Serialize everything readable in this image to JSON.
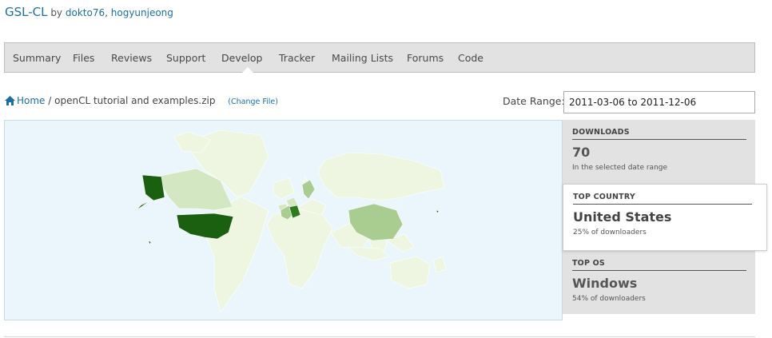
{
  "header": {
    "project_title": "GSL-CL",
    "by_text": "by",
    "authors": [
      "dokto76",
      "hogyunjeong"
    ],
    "separator": ","
  },
  "nav": {
    "tabs": [
      {
        "label": "Summary"
      },
      {
        "label": "Files"
      },
      {
        "label": "Reviews"
      },
      {
        "label": "Support"
      },
      {
        "label": "Develop",
        "active": true
      },
      {
        "label": "Tracker"
      },
      {
        "label": "Mailing Lists"
      },
      {
        "label": "Forums"
      },
      {
        "label": "Code"
      }
    ]
  },
  "breadcrumb": {
    "home_icon": "home-icon",
    "home_label": "Home",
    "separator": "/",
    "file_name": "openCL tutorial and examples.zip",
    "change_file": "(Change File)"
  },
  "date_range": {
    "label": "Date Range:",
    "value": "2011-03-06 to 2011-12-06"
  },
  "map": {
    "ocean_color": "#eaf6fb",
    "land_low_color": "#eef5e0",
    "land_mid_color": "#d2e7c2",
    "land_med_color": "#a9cd91",
    "land_high_color": "#2e7a1e",
    "land_top_color": "#1b5f11"
  },
  "stats": {
    "downloads": {
      "label": "DOWNLOADS",
      "value": "70",
      "sub": "In the selected date range"
    },
    "top_country": {
      "label": "TOP COUNTRY",
      "value": "United States",
      "sub": "25% of downloaders"
    },
    "top_os": {
      "label": "TOP OS",
      "value": "Windows",
      "sub": "54% of downloaders"
    }
  }
}
